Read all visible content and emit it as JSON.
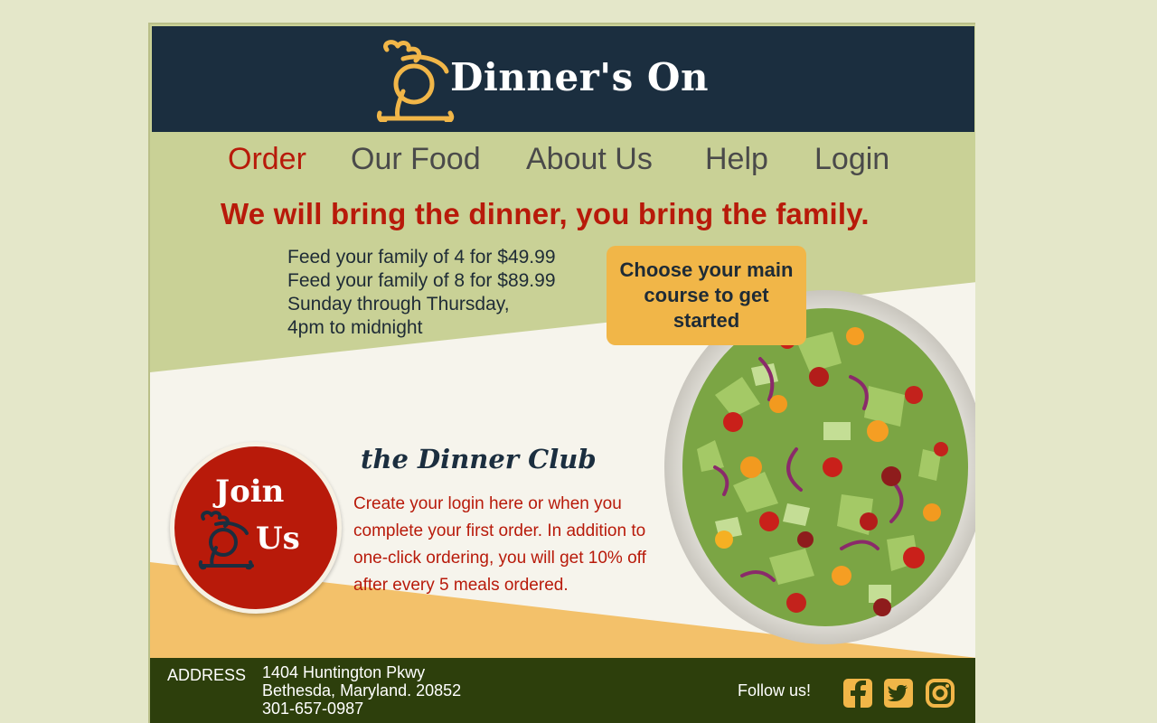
{
  "brand": {
    "name": "Dinner's On"
  },
  "nav": [
    {
      "label": "Order",
      "active": true
    },
    {
      "label": "Our Food"
    },
    {
      "label": "About Us"
    },
    {
      "label": "Help"
    },
    {
      "label": "Login"
    }
  ],
  "hero": {
    "tagline": "We will bring the dinner, you bring the family.",
    "offers": [
      "Feed your family of 4 for $49.99",
      "Feed your family of 8 for $89.99",
      "Sunday through Thursday,",
      "4pm to midnight"
    ],
    "cta_label": "Choose your main course to get started"
  },
  "club": {
    "join_word1": "Join",
    "join_word2": "Us",
    "title": "the Dinner Club",
    "description": "Create your login here or when you complete your first order.  In addition to one-click ordering, you will get 10% off after every 5 meals ordered."
  },
  "footer": {
    "address_label": "ADDRESS",
    "address_lines": [
      "1404 Huntington Pkwy",
      "Bethesda, Maryland. 20852",
      "301-657-0987"
    ],
    "follow_label": "Follow us!",
    "social": [
      "facebook-icon",
      "twitter-icon",
      "instagram-icon"
    ]
  },
  "colors": {
    "navy": "#1b2e3f",
    "sage": "#c9d196",
    "cream": "#f6f4ec",
    "red": "#b81a0a",
    "gold": "#f1b648",
    "olive": "#2d3f0c"
  }
}
